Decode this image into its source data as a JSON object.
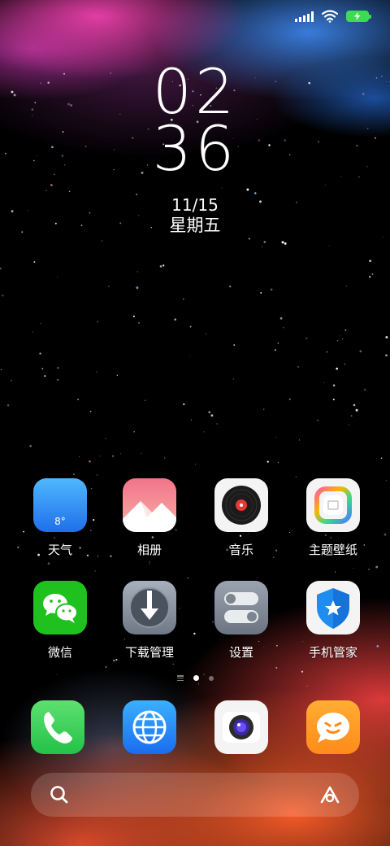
{
  "clock": {
    "hour": "02",
    "minute": "36",
    "date": "11/15",
    "weekday": "星期五"
  },
  "statusbar": {
    "icons": [
      "signal-icon",
      "wifi-icon",
      "battery-charging-icon"
    ]
  },
  "apps": [
    {
      "label": "天气",
      "icon": "weather-icon",
      "badge": "8°"
    },
    {
      "label": "相册",
      "icon": "gallery-icon"
    },
    {
      "label": "音乐",
      "icon": "music-icon"
    },
    {
      "label": "主题壁纸",
      "icon": "themes-icon"
    },
    {
      "label": "微信",
      "icon": "wechat-icon"
    },
    {
      "label": "下载管理",
      "icon": "downloads-icon"
    },
    {
      "label": "设置",
      "icon": "settings-icon"
    },
    {
      "label": "手机管家",
      "icon": "security-icon"
    }
  ],
  "dock": [
    {
      "icon": "phone-icon"
    },
    {
      "icon": "browser-icon"
    },
    {
      "icon": "camera-icon"
    },
    {
      "icon": "messages-icon"
    }
  ],
  "page_indicator": {
    "pages": 2,
    "active": 1
  },
  "search": {
    "icons": [
      "search-icon",
      "assistant-icon"
    ]
  },
  "colors": {
    "battery": "#3ddc50",
    "weather": "#2f8cf5",
    "wechat": "#1fc11f",
    "phone": "#37d45a",
    "messages": "#ff9a1f"
  }
}
